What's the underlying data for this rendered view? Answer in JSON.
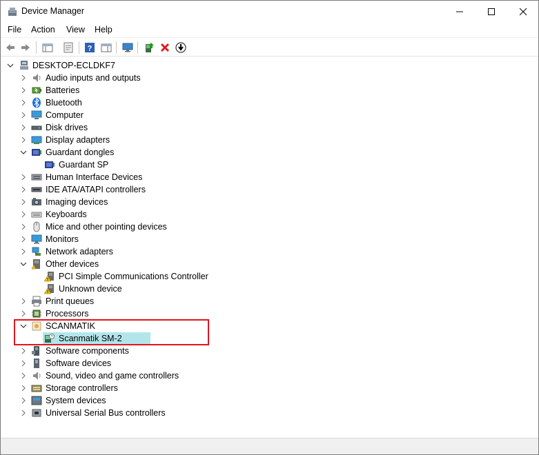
{
  "window": {
    "title": "Device Manager"
  },
  "menu": {
    "file": "File",
    "action": "Action",
    "view": "View",
    "help": "Help"
  },
  "toolbar": {
    "icons": [
      "back-icon",
      "forward-icon",
      "show-hide-console-tree-icon",
      "properties-icon",
      "help-icon",
      "action-pane-icon",
      "monitor-icon",
      "update-driver-icon",
      "uninstall-icon",
      "scan-hardware-icon"
    ]
  },
  "tree": {
    "root": "DESKTOP-ECLDKF7",
    "items": [
      {
        "label": "Audio inputs and outputs",
        "expanded": false,
        "icon": "audio-icon"
      },
      {
        "label": "Batteries",
        "expanded": false,
        "icon": "battery-icon"
      },
      {
        "label": "Bluetooth",
        "expanded": false,
        "icon": "bluetooth-icon"
      },
      {
        "label": "Computer",
        "expanded": false,
        "icon": "computer-icon"
      },
      {
        "label": "Disk drives",
        "expanded": false,
        "icon": "disk-icon"
      },
      {
        "label": "Display adapters",
        "expanded": false,
        "icon": "display-adapter-icon"
      },
      {
        "label": "Guardant dongles",
        "expanded": true,
        "icon": "dongle-icon"
      },
      {
        "label": "Guardant SP",
        "child": true,
        "icon": "dongle-icon"
      },
      {
        "label": "Human Interface Devices",
        "expanded": false,
        "icon": "hid-icon"
      },
      {
        "label": "IDE ATA/ATAPI controllers",
        "expanded": false,
        "icon": "ide-icon"
      },
      {
        "label": "Imaging devices",
        "expanded": false,
        "icon": "camera-icon"
      },
      {
        "label": "Keyboards",
        "expanded": false,
        "icon": "keyboard-icon"
      },
      {
        "label": "Mice and other pointing devices",
        "expanded": false,
        "icon": "mouse-icon"
      },
      {
        "label": "Monitors",
        "expanded": false,
        "icon": "monitor-icon"
      },
      {
        "label": "Network adapters",
        "expanded": false,
        "icon": "network-icon"
      },
      {
        "label": "Other devices",
        "expanded": true,
        "icon": "other-devices-icon"
      },
      {
        "label": "PCI Simple Communications Controller",
        "child": true,
        "icon": "warning-device-icon"
      },
      {
        "label": "Unknown device",
        "child": true,
        "icon": "warning-device-icon"
      },
      {
        "label": "Print queues",
        "expanded": false,
        "icon": "printer-icon"
      },
      {
        "label": "Processors",
        "expanded": false,
        "icon": "processor-icon"
      },
      {
        "label": "SCANMATIK",
        "expanded": true,
        "icon": "scanmatik-icon"
      },
      {
        "label": "Scanmatik SM-2",
        "child": true,
        "selected": true,
        "icon": "scanmatik-device-icon"
      },
      {
        "label": "Software components",
        "expanded": false,
        "icon": "software-component-icon"
      },
      {
        "label": "Software devices",
        "expanded": false,
        "icon": "software-device-icon"
      },
      {
        "label": "Sound, video and game controllers",
        "expanded": false,
        "icon": "sound-icon"
      },
      {
        "label": "Storage controllers",
        "expanded": false,
        "icon": "storage-icon"
      },
      {
        "label": "System devices",
        "expanded": false,
        "icon": "system-icon"
      },
      {
        "label": "Universal Serial Bus controllers",
        "expanded": false,
        "icon": "usb-icon"
      }
    ]
  },
  "colors": {
    "selection": "#b3e6eb",
    "highlight_border": "#e0141e",
    "uninstall_red": "#e01b1b"
  }
}
